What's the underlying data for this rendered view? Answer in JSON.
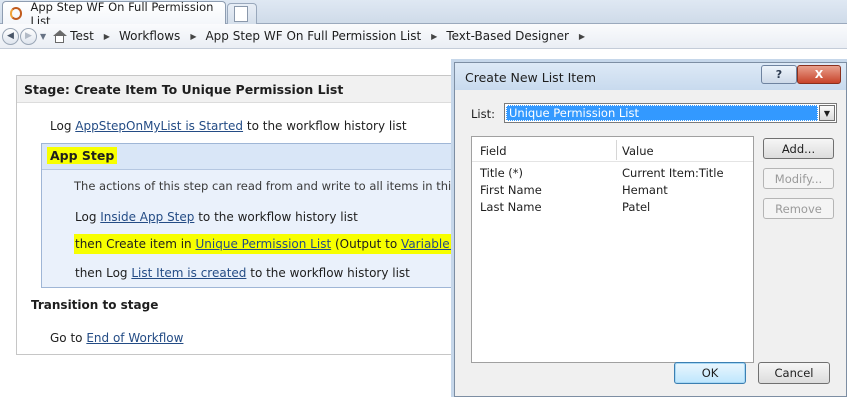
{
  "browser": {
    "tab_title": "App Step WF On Full Permission List",
    "breadcrumb": [
      "Test",
      "Workflows",
      "App Step WF On Full Permission List",
      "Text-Based Designer"
    ]
  },
  "designer": {
    "stage_title": "Stage: Create Item To Unique Permission List",
    "log1": {
      "prefix": "Log",
      "link": "AppStepOnMyList is Started",
      "suffix": "to the workflow history list"
    },
    "app_step": {
      "title": "App Step",
      "description": "The actions of this step can read from and write to all items in this site.",
      "log2": {
        "prefix": "Log",
        "link": "Inside App Step",
        "suffix": "to the workflow history list"
      },
      "create": {
        "prefix": "then Create item in",
        "list_link": "Unique Permission List",
        "mid": "(Output to",
        "var_link": "Variable: create",
        "suffix": ")"
      },
      "log3": {
        "prefix": "then Log",
        "link": "List Item is created",
        "suffix": "to the workflow history list"
      }
    },
    "transition_title": "Transition to stage",
    "goto": {
      "prefix": "Go to",
      "link": "End of Workflow"
    }
  },
  "dialog": {
    "title": "Create New List Item",
    "help_label": "?",
    "close_label": "X",
    "list_label": "List:",
    "list_value": "Unique Permission List",
    "columns": {
      "field": "Field",
      "value": "Value"
    },
    "rows": [
      {
        "field": "Title (*)",
        "value": "Current Item:Title"
      },
      {
        "field": "First Name",
        "value": "Hemant"
      },
      {
        "field": "Last Name",
        "value": "Patel"
      }
    ],
    "buttons": {
      "add": "Add...",
      "modify": "Modify...",
      "remove": "Remove",
      "ok": "OK",
      "cancel": "Cancel"
    }
  },
  "colors": {
    "highlight": "#f7ff00",
    "link": "#244c85",
    "selection": "#3399ff"
  }
}
